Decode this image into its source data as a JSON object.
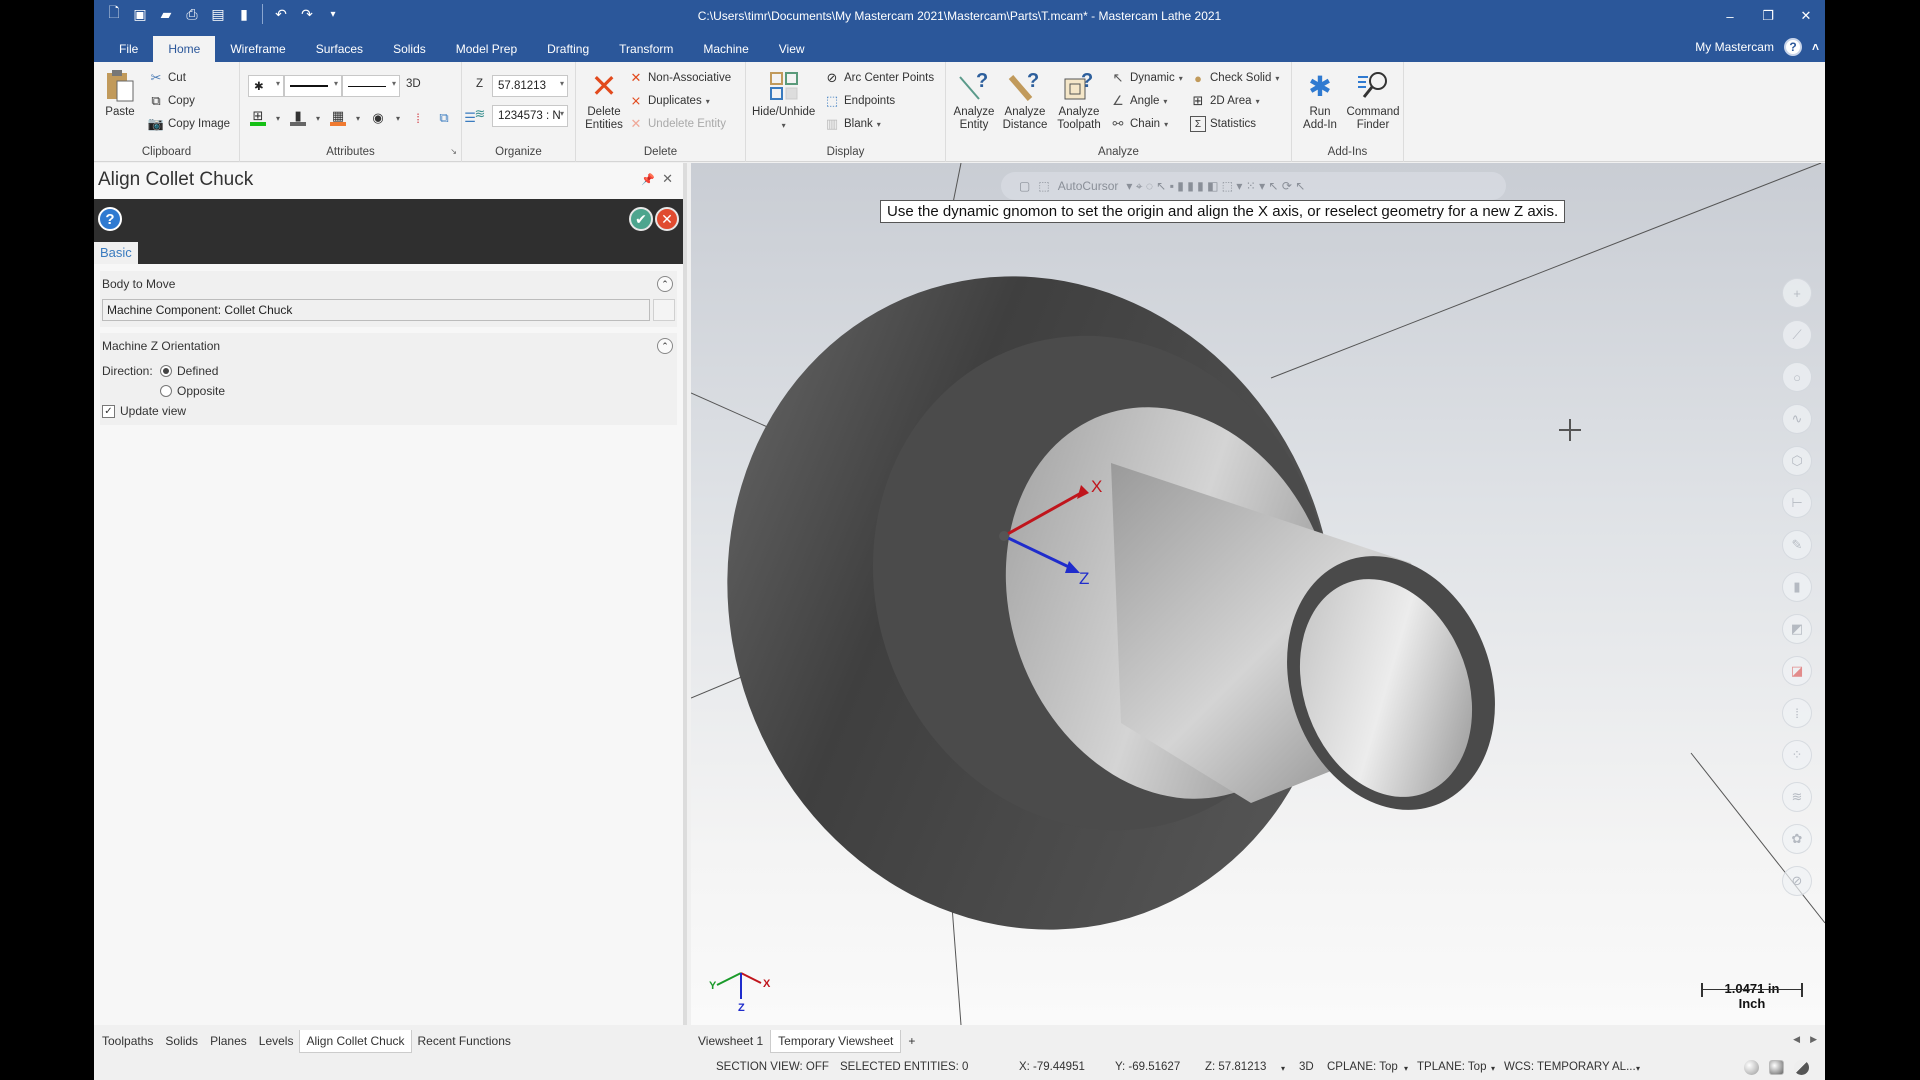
{
  "window": {
    "title": "C:\\Users\\timr\\Documents\\My Mastercam 2021\\Mastercam\\Parts\\T.mcam* - Mastercam Lathe 2021",
    "controls": {
      "minimize": "–",
      "restore": "❐",
      "close": "✕"
    }
  },
  "quick_access": [
    "new-file-icon",
    "save-icon",
    "open-icon",
    "print-icon",
    "save-as-icon",
    "convert-icon",
    "undo-icon",
    "redo-icon",
    "customize-icon"
  ],
  "ribbon": {
    "tabs": [
      "File",
      "Home",
      "Wireframe",
      "Surfaces",
      "Solids",
      "Model Prep",
      "Drafting",
      "Transform",
      "Machine",
      "View"
    ],
    "active_tab": "Home",
    "account_label": "My Mastercam",
    "help_label": "?",
    "collapse_label": "˄",
    "groups": {
      "clipboard": {
        "label": "Clipboard",
        "paste": "Paste",
        "cut": "Cut",
        "copy": "Copy",
        "copy_image": "Copy Image"
      },
      "attributes": {
        "label": "Attributes",
        "point_style": "✱",
        "mode_3d": "3D"
      },
      "organize": {
        "label": "Organize",
        "z_label": "Z",
        "z_value": "57.81213",
        "level_value": "1234573 : N"
      },
      "delete": {
        "label": "Delete",
        "delete_entities": "Delete Entities",
        "non_associative": "Non-Associative",
        "duplicates": "Duplicates",
        "undelete_entity": "Undelete Entity"
      },
      "display": {
        "label": "Display",
        "hide_unhide": "Hide/Unhide",
        "arc_center_points": "Arc Center Points",
        "endpoints": "Endpoints",
        "blank": "Blank"
      },
      "analyze": {
        "label": "Analyze",
        "analyze_entity": "Analyze Entity",
        "analyze_distance": "Analyze Distance",
        "analyze_toolpath": "Analyze Toolpath",
        "dynamic": "Dynamic",
        "angle": "Angle",
        "chain": "Chain",
        "check_solid": "Check Solid",
        "area_2d": "2D Area",
        "statistics": "Statistics"
      },
      "addins": {
        "label": "Add-Ins",
        "run_addin": "Run Add-In",
        "command_finder": "Command Finder"
      }
    }
  },
  "panel": {
    "title": "Align Collet Chuck",
    "tab": "Basic",
    "body_to_move": {
      "heading": "Body to Move",
      "value": "Machine Component: Collet Chuck"
    },
    "orientation": {
      "heading": "Machine Z Orientation",
      "direction_label": "Direction:",
      "options": [
        "Defined",
        "Opposite"
      ],
      "selected": "Defined",
      "update_view_label": "Update view",
      "update_view_checked": true
    }
  },
  "bottom_tabs": [
    "Toolpaths",
    "Solids",
    "Planes",
    "Levels",
    "Align Collet Chuck",
    "Recent Functions"
  ],
  "bottom_active": "Align Collet Chuck",
  "viewport": {
    "autocursor_label": "AutoCursor",
    "prompt": "Use the dynamic gnomon to set the origin and align the X axis, or reselect geometry for a new Z axis.",
    "gnomon": {
      "x": "X",
      "z": "Z"
    },
    "triad": {
      "x": "X",
      "y": "Y",
      "z": "Z"
    },
    "scale": {
      "value": "1.0471 in",
      "units": "Inch"
    },
    "right_toolbar": [
      "point-icon",
      "line-icon",
      "circle-icon",
      "spline-icon",
      "solid-view-icon",
      "dimension-icon",
      "measure-icon",
      "shading-icon",
      "plane-icon",
      "level-icon",
      "list-icon",
      "grid-icon",
      "layers-icon",
      "settings-icon",
      "no-entry-icon"
    ]
  },
  "viewsheets": {
    "tabs": [
      "Viewsheet 1",
      "Temporary Viewsheet"
    ],
    "active": "Temporary Viewsheet",
    "add_label": "+"
  },
  "status": {
    "section_view": "SECTION VIEW: OFF",
    "selected_entities": "SELECTED ENTITIES: 0",
    "x": "X:   -79.44951",
    "y": "Y:   -69.51627",
    "z": "Z:   57.81213",
    "mode": "3D",
    "cplane": "CPLANE: Top",
    "tplane": "TPLANE: Top",
    "wcs": "WCS: TEMPORARY AL..."
  },
  "colors": {
    "brand_blue": "#2b579a",
    "accent_tab": "#3a7bbf",
    "ok_green": "#4da58e",
    "cancel_red": "#e04b2f",
    "gnomon_x": "#c0151c",
    "gnomon_z": "#1f2ccc"
  }
}
